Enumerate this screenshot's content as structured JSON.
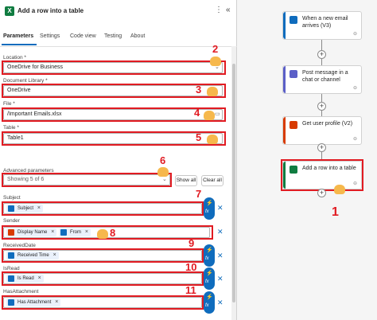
{
  "header": {
    "title": "Add a row into a table",
    "more_icon": "⋮",
    "collapse_icon": "«"
  },
  "tabs": [
    {
      "label": "Parameters"
    },
    {
      "label": "Settings"
    },
    {
      "label": "Code view"
    },
    {
      "label": "Testing"
    },
    {
      "label": "About"
    }
  ],
  "params": {
    "location": {
      "label": "Location *",
      "value": "OneDrive for Business"
    },
    "library": {
      "label": "Document Library *",
      "value": "OneDrive"
    },
    "file": {
      "label": "File *",
      "value": "/Important Emails.xlsx"
    },
    "table": {
      "label": "Table *",
      "value": "Table1"
    }
  },
  "advanced": {
    "label": "Advanced parameters",
    "value": "Showing 5 of 6",
    "show_all": "Show all",
    "clear_all": "Clear all"
  },
  "columns": [
    {
      "label": "Subject",
      "token": "Subject"
    },
    {
      "label": "Sender",
      "token": "Display Name",
      "token2": "From"
    },
    {
      "label": "ReceivedDate",
      "token": "Received Time"
    },
    {
      "label": "IsRead",
      "token": "Is Read"
    },
    {
      "label": "HasAttachment",
      "token": "Has Attachment"
    }
  ],
  "annotations": [
    "1",
    "2",
    "3",
    "4",
    "5",
    "6",
    "7",
    "8",
    "9",
    "10",
    "11"
  ],
  "flow": [
    {
      "title": "When a new email arrives (V3)",
      "color": "#0f6cbd"
    },
    {
      "title": "Post message in a chat or channel",
      "color": "#5b5fc7"
    },
    {
      "title": "Get user profile (V2)",
      "color": "#d83b01"
    },
    {
      "title": "Add a row into a table",
      "color": "#107c41"
    }
  ],
  "colors": {
    "accent": "#0f6cbd",
    "annotation": "#e11b22",
    "excel": "#107c41"
  }
}
